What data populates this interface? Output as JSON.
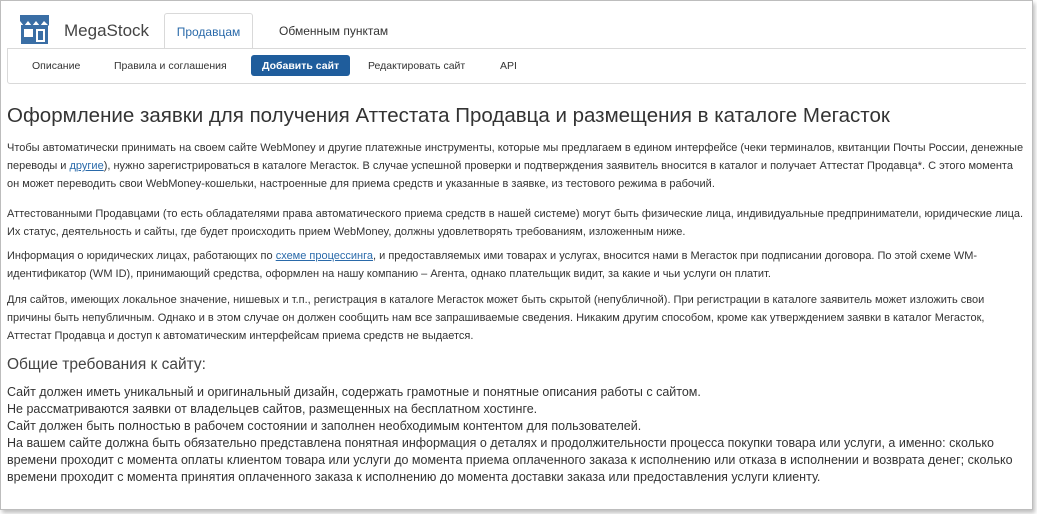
{
  "header": {
    "brand": "MegaStock",
    "tabs": [
      {
        "label": "Продавцам",
        "active": true
      },
      {
        "label": "Обменным пунктам",
        "active": false
      }
    ]
  },
  "subnav": [
    {
      "label": "Описание",
      "active": false
    },
    {
      "label": "Правила и соглашения",
      "active": false
    },
    {
      "label": "Добавить сайт",
      "active": true
    },
    {
      "label": "Редактировать сайт",
      "active": false
    },
    {
      "label": "API",
      "active": false
    }
  ],
  "content": {
    "title": "Оформление заявки для получения Аттестата Продавца и размещения в каталоге Мегасток",
    "p1": {
      "before": "Чтобы автоматически принимать на своем сайте WebMoney и другие платежные инструменты, которые мы предлагаем в едином интерфейсе (чеки терминалов, квитанции Почты России, денежные переводы и ",
      "link": "другие",
      "after": "), нужно зарегистрироваться в каталоге Мегасток. В случае успешной проверки и подтверждения заявитель вносится в каталог и получает Аттестат Продавца*. С этого момента он может переводить свои WebMoney-кошельки, настроенные для приема средств и указанные в заявке, из тестового режима в рабочий."
    },
    "p2": "Аттестованными Продавцами (то есть обладателями права автоматического приема средств в нашей системе) могут быть физические лица, индивидуальные предприниматели, юридические лица. Их статус, деятельность и сайты, где будет происходить прием WebMoney, должны удовлетворять требованиям, изложенным ниже.",
    "p3": {
      "before": "Информация о юридических лицах, работающих по ",
      "link": "схеме процессинга",
      "after": ", и предоставляемых ими товарах и услугах, вносится нами в Мегасток при подписании договора. По этой схеме WM-идентификатор (WM ID), принимающий средства, оформлен на нашу компанию – Агента, однако плательщик видит, за какие и чьи услуги он платит."
    },
    "p4": "Для сайтов, имеющих локальное значение, нишевых и т.п., регистрация в каталоге Мегасток может быть скрытой (непубличной). При регистрации в каталоге заявитель может изложить свои причины быть непубличным. Однако и в этом случае он должен сообщить нам все запрашиваемые сведения. Никаким другим способом, кроме как утверждением заявки в каталог Мегасток, Аттестат Продавца и доступ к автоматическим интерфейсам приема средств не выдается.",
    "subheading": "Общие требования к сайту:",
    "requirements": [
      "Сайт должен иметь уникальный и оригинальный дизайн, содержать грамотные и понятные описания работы с сайтом.",
      "Не рассматриваются заявки от владельцев сайтов, размещенных на бесплатном хостинге.",
      "Сайт должен быть полностью в рабочем состоянии и заполнен необходимым контентом для пользователей.",
      "На вашем сайте должна быть обязательно представлена понятная информация о деталях и продолжительности процесса покупки товара или услуги, а именно: сколько времени проходит с момента оплаты клиентом товара или услуги до момента приема оплаченного заказа к исполнению или отказа в исполнении и возврата денег; сколько времени проходит с момента принятия оплаченного заказа к исполнению до момента доставки заказа или предоставления услуги клиенту."
    ]
  },
  "colors": {
    "accent": "#1f5d9c",
    "link": "#2a6aaa",
    "logo": "#3a6ea5"
  }
}
